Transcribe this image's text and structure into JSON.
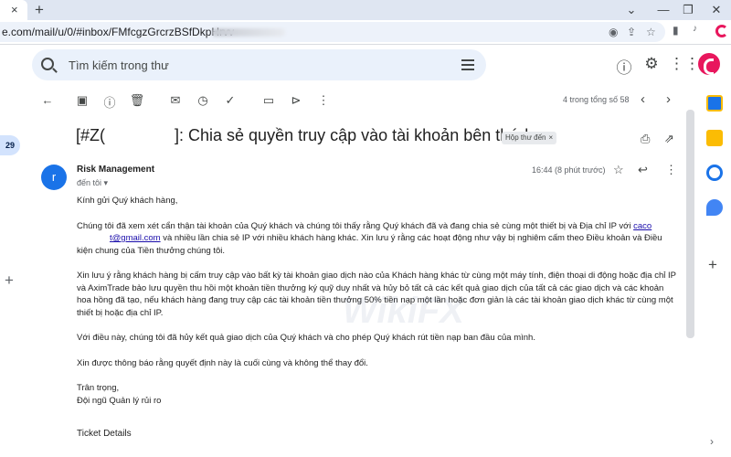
{
  "browser": {
    "tab_close": "×",
    "new_tab": "+",
    "url": "e.com/mail/u/0/#inbox/FMfcgzGrcrzBSfDkpHrvv",
    "window_controls": [
      "⌄",
      "—",
      "❐",
      "✕"
    ]
  },
  "header": {
    "search_placeholder": "Tìm kiếm trong thư"
  },
  "left_rail": {
    "badge_count": "29",
    "add_label": "+"
  },
  "toolbar": {
    "pager_text": "4 trong tổng số 58"
  },
  "email": {
    "subject_start": "[#Z(",
    "subject_end": "]: Chia sẻ quyền truy cập vào tài khoản bên thứ ba",
    "label_chip": "Hộp thư đến",
    "label_chip_remove": "×",
    "sender_initial": "r",
    "sender_name": "Risk Management",
    "recipient": "đến tôi ▾",
    "time": "16:44 (8 phút trước)",
    "greeting": "Kính gửi Quý khách hàng,",
    "p1_a": "Chúng tôi đã xem xét cẩn thận tài khoản của Quý khách và chúng tôi thấy rằng Quý khách đã và đang chia sẻ cùng một thiết bị và Địa chỉ IP với ",
    "p1_link_a": "caco",
    "p1_link_b": "t@gmail.com",
    "p1_b": " và nhiều lần chia sẻ IP với nhiều khách hàng khác. Xin lưu ý rằng các hoạt động như vậy bị nghiêm cấm theo Điều khoản và Điều kiện chung của Tiền thưởng chúng tôi.",
    "p2": "Xin lưu ý rằng khách hàng bị cấm truy cập vào bất kỳ tài khoản giao dịch nào của Khách hàng khác từ cùng một máy tính, điện thoại di động hoặc địa chỉ IP và AximTrade bảo lưu quyền thu hồi một khoản tiền thưởng ký quỹ duy nhất và hủy bỏ tất cả các kết quả giao dịch của tất cả các giao dịch và các khoản hoa hồng đã tạo, nếu khách hàng đang truy cập các tài khoản tiền thưởng 50% tiền nạp một lần hoặc đơn giản là các tài khoản giao dịch khác từ cùng một thiết bị hoặc địa chỉ IP.",
    "p3": "Với điều này, chúng tôi đã hủy kết quả giao dịch của Quý khách và cho phép Quý khách rút tiền nạp ban đầu của mình.",
    "p4": "Xin được thông báo rằng quyết định này là cuối cùng và không thể thay đổi.",
    "closing": "Trân trọng,",
    "signature": "Đội ngũ Quản lý rủi ro",
    "ticket_heading": "Ticket Details"
  },
  "watermark": "WikiFX",
  "colors": {
    "accent_blue": "#1a73e8",
    "search_bg": "#eaf1fb",
    "profile_red": "#e8175d",
    "link": "#1a0dab"
  }
}
